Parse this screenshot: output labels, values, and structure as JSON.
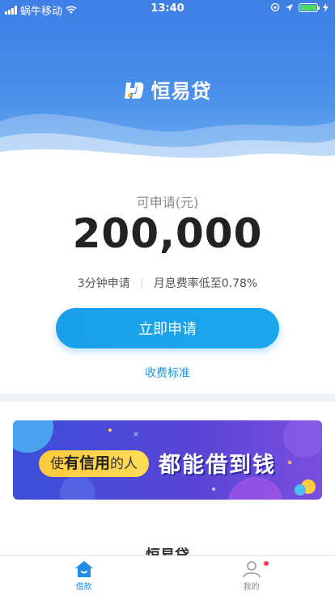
{
  "status_bar": {
    "carrier": "蜗牛移动",
    "time": "13:40"
  },
  "header": {
    "app_name": "恒易贷"
  },
  "loan": {
    "amount_label": "可申请(元)",
    "amount": "200,000",
    "feature_1": "3分钟申请",
    "feature_2": "月息费率低至0.78%",
    "apply_button": "立即申请",
    "fee_link": "收费标准"
  },
  "banner": {
    "text_prefix": "使",
    "text_bold": "有信用",
    "text_suffix": "的人",
    "text_big": "都能借到钱"
  },
  "section": {
    "title": "恒易贷"
  },
  "tabbar": {
    "tabs": [
      {
        "label": "借款",
        "icon": "home-icon",
        "active": true
      },
      {
        "label": "我的",
        "icon": "user-icon",
        "active": false
      }
    ]
  },
  "colors": {
    "header_blue": "#3e7fe6",
    "button_blue": "#1aa0ea",
    "link_blue": "#2196d9",
    "tab_active": "#1f8ee6",
    "badge_red": "#ff3b5c",
    "battery_green": "#4cd964"
  }
}
